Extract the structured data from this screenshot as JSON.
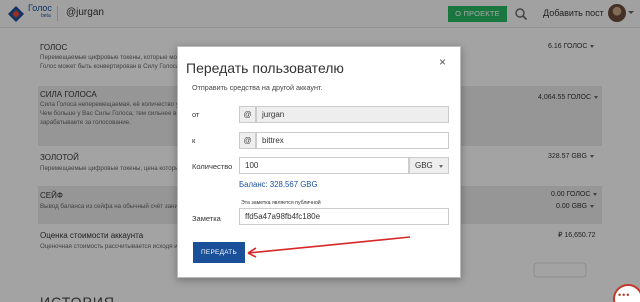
{
  "header": {
    "brand": "Голос",
    "brand_beta": "beta",
    "username": "@jurgan",
    "about_button": "О ПРОЕКТЕ",
    "add_post": "Добавить пост"
  },
  "wallet": {
    "rows": [
      {
        "title": "ГОЛОС",
        "desc": [
          "Перемещаемые цифровые токены, которые могут быть переданы куда угодно в любой момент.",
          "Голос может быть конвертирован в Силу Голоса"
        ],
        "values": [
          "6.16 ГОЛОС"
        ]
      },
      {
        "title": "СИЛА ГОЛОСА",
        "desc": [
          "Сила Голоса неперемещаемая, её количество увеличивается при долгосрочном хранении.",
          "Чем больше у Вас Силы Голоса, тем сильнее вы влияете на вознаграждения за пост и тем больше",
          "зарабатываете за голосование."
        ],
        "values": [
          "4,064.55 ГОЛОС"
        ]
      },
      {
        "title": "ЗОЛОТОЙ",
        "desc": [
          "Перемещаемые цифровые токены, цена которых всегда равна 1 мг золота."
        ],
        "values": [
          "328.57 GBG"
        ]
      },
      {
        "title": "СЕЙФ",
        "desc": [
          "Вывод баланса из сейфа на обычный счёт занимает 3 дня."
        ],
        "values": [
          "0.00 ГОЛОС",
          "0.00 GBG"
        ]
      },
      {
        "title": "Оценка стоимости аккаунта",
        "desc": [
          "Оценочная стоимость рассчитывается исходя из цены ГОЛОСА и ЗОЛОТОГО."
        ],
        "values": [
          "₽ 16,650.72"
        ]
      }
    ],
    "history_title": "ИСТОРИЯ"
  },
  "modal": {
    "title": "Передать пользователю",
    "close": "×",
    "subtitle": "Отправить средства на другой аккаунт.",
    "from_label": "от",
    "from_value": "jurgan",
    "to_label": "к",
    "to_value": "bittrex",
    "at_symbol": "@",
    "amount_label": "Количество",
    "amount_value": "100",
    "currency": "GBG",
    "balance": "Баланс: 328.567 GBG",
    "public_note": "Эта заметка является публичной",
    "memo_label": "Заметка",
    "memo_value": "ffd5a47a98fb4fc180e",
    "submit": "ПЕРЕДАТЬ"
  },
  "colors": {
    "accent": "#1a5099",
    "green": "#29b662",
    "annotation": "#d62828"
  }
}
